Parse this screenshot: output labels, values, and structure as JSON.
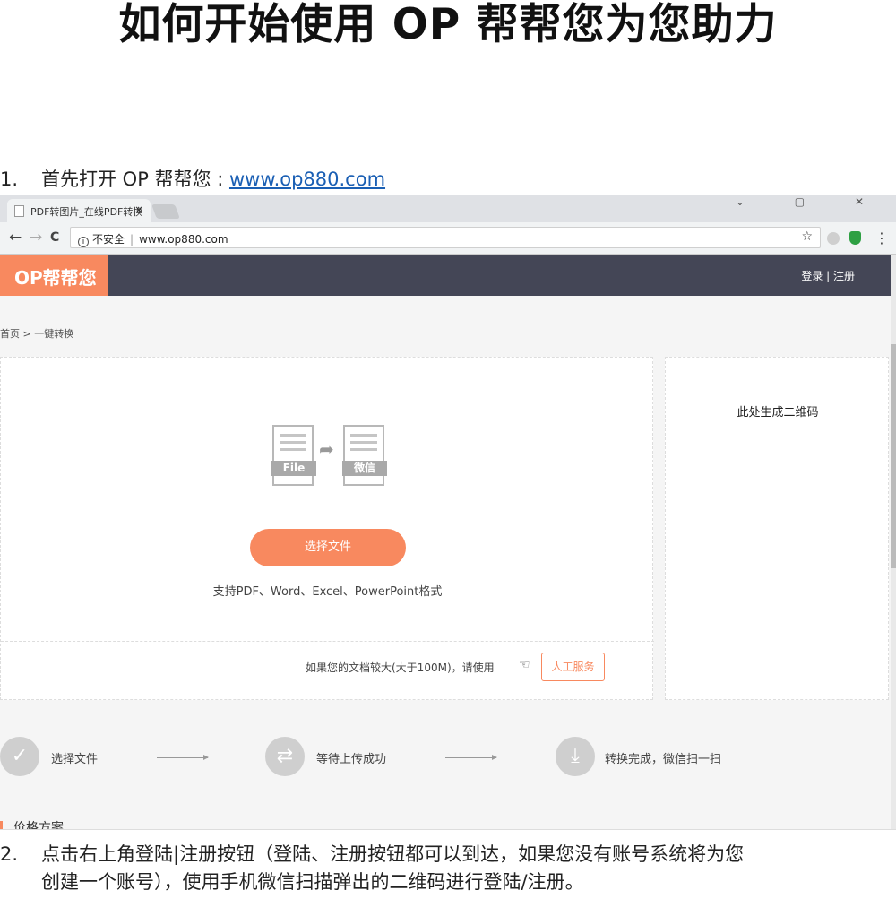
{
  "doc": {
    "title": "如何开始使用 OP 帮帮您为您助力",
    "step1": {
      "num": "1.",
      "text": "首先打开 OP 帮帮您 : ",
      "link": "www.op880.com"
    },
    "step2": {
      "num": "2.",
      "line1": "点击右上角登陆|注册按钮（登陆、注册按钮都可以到达，如果您没有账号系统将为您",
      "line2": "创建一个账号），使用手机微信扫描弹出的二维码进行登陆/注册。"
    }
  },
  "browser": {
    "tab_title": "PDF转图片_在线PDF转换",
    "tab_close": "×",
    "window_controls": "⌄ ▢ ✕",
    "back": "←",
    "forward": "→",
    "reload": "C",
    "security": "不安全",
    "url": "www.op880.com",
    "star": "☆",
    "menu": "⋮"
  },
  "site": {
    "logo": "OP帮帮您",
    "login_links": "登录 | 注册",
    "breadcrumb": "首页 >  一键转换",
    "file_tag": "File",
    "wechat_tag": "微信",
    "choose_button": "选择文件",
    "support_text": "支持PDF、Word、Excel、PowerPoint格式",
    "big_doc_text": "如果您的文档较大(大于100M)，请使用",
    "manual_button": "人工服务",
    "qr_text": "此处生成二维码",
    "steps": [
      {
        "icon": "✓",
        "label": "选择文件"
      },
      {
        "icon": "⇄",
        "label": "等待上传成功"
      },
      {
        "icon": "⤓",
        "label": "转换完成，微信扫一扫"
      }
    ],
    "price_title": "价格方案"
  }
}
